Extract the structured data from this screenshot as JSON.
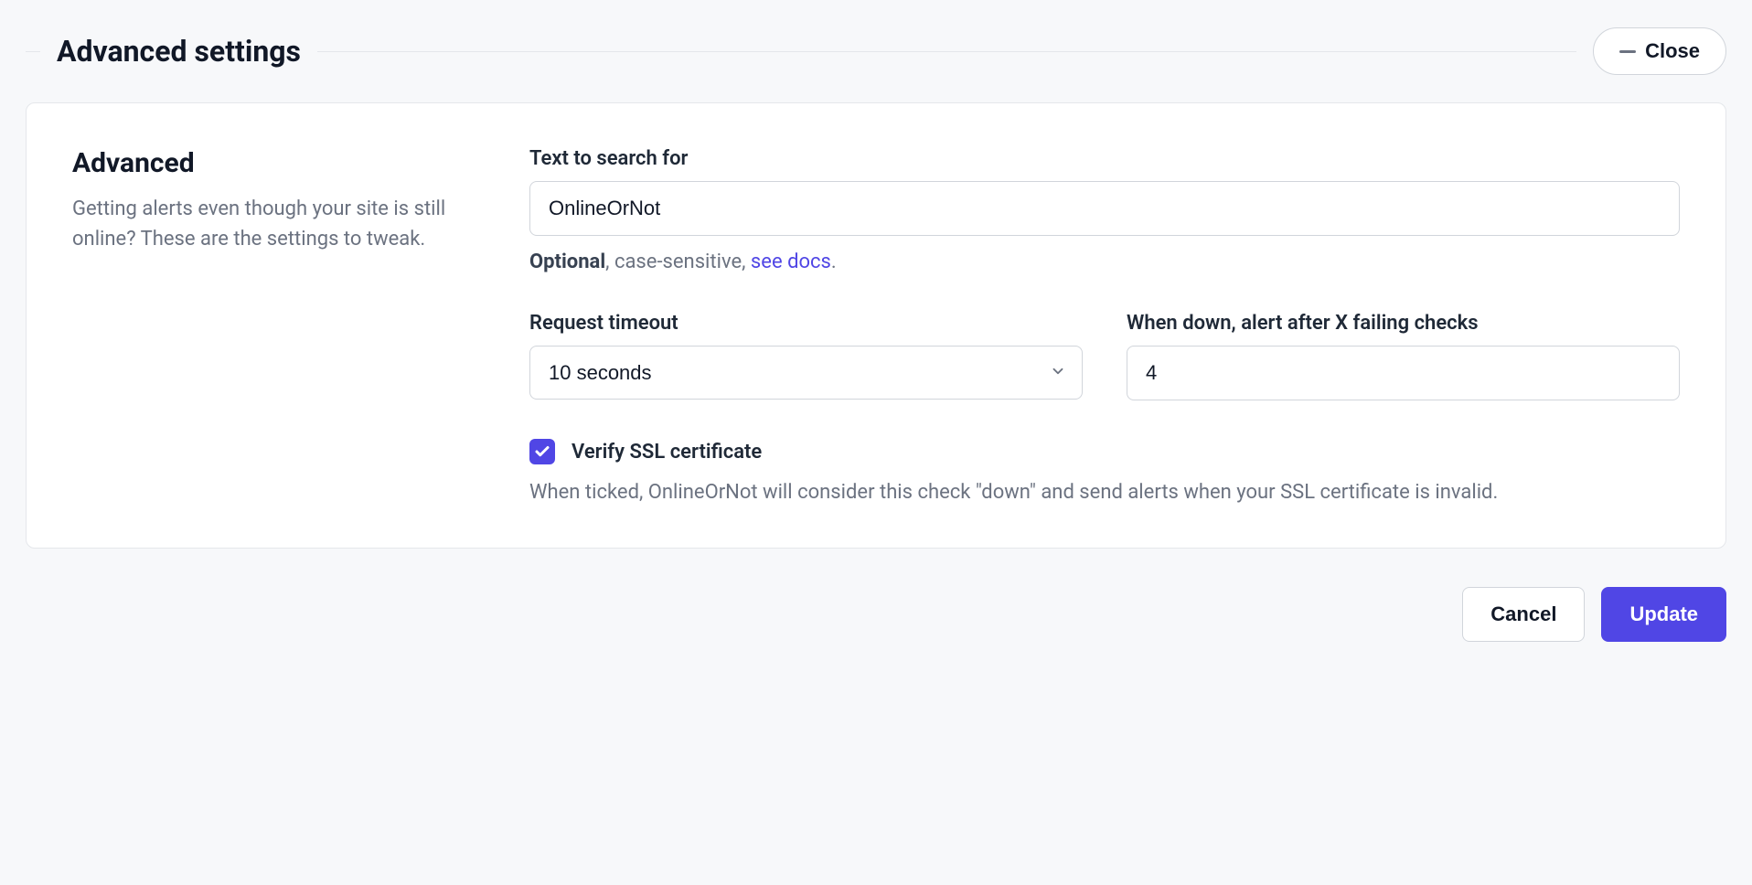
{
  "header": {
    "title": "Advanced settings",
    "close_label": "Close"
  },
  "left": {
    "title": "Advanced",
    "description": "Getting alerts even though your site is still online? These are the settings to tweak."
  },
  "fields": {
    "text_search": {
      "label": "Text to search for",
      "value": "OnlineOrNot",
      "hint_strong": "Optional",
      "hint_rest": ", case-sensitive, ",
      "hint_link": "see docs",
      "hint_period": "."
    },
    "timeout": {
      "label": "Request timeout",
      "value": "10 seconds"
    },
    "alert_after": {
      "label": "When down, alert after X failing checks",
      "value": "4"
    },
    "verify_ssl": {
      "label": "Verify SSL certificate",
      "checked": true,
      "description": "When ticked, OnlineOrNot will consider this check \"down\" and send alerts when your SSL certificate is invalid."
    }
  },
  "footer": {
    "cancel": "Cancel",
    "update": "Update"
  }
}
